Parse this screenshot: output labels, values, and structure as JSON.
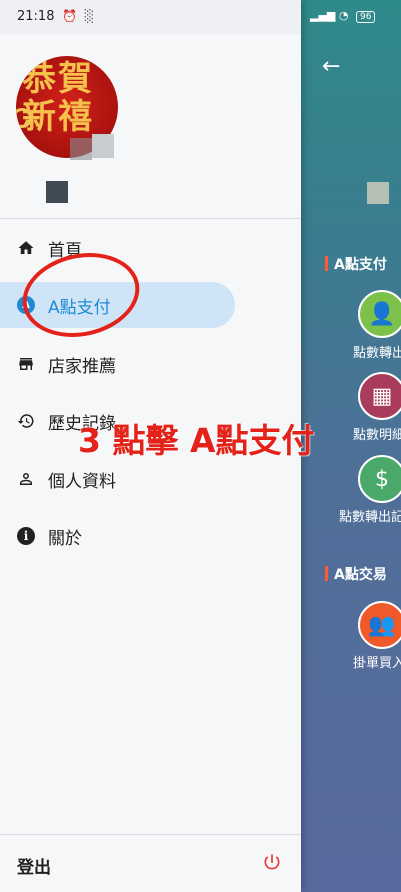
{
  "status_bar": {
    "time": "21:18",
    "left_icons": "⏰ ░",
    "battery": "96"
  },
  "background_app": {
    "back_label": "←",
    "sections": [
      {
        "title": "A點支付"
      },
      {
        "title": "A點交易"
      }
    ],
    "items": [
      {
        "label": "點數轉出",
        "icon": "person-transfer-icon",
        "color": "#7cc24a"
      },
      {
        "label": "點數明細",
        "icon": "calendar-dollar-icon",
        "color": "#a93b5c"
      },
      {
        "label": "點數轉出記錄",
        "icon": "dollar-up-icon",
        "color": "#4aa86a"
      },
      {
        "label": "掛單買入",
        "icon": "people-down-icon",
        "color": "#f05a2a"
      }
    ]
  },
  "drawer": {
    "avatar_text": "恭賀新禧",
    "menu": [
      {
        "label": "首頁",
        "icon": "home-icon"
      },
      {
        "label": "A點支付",
        "icon": "a-point-icon",
        "active": true
      },
      {
        "label": "店家推薦",
        "icon": "store-icon"
      },
      {
        "label": "歷史記錄",
        "icon": "history-icon"
      },
      {
        "label": "個人資料",
        "icon": "person-icon"
      },
      {
        "label": "關於",
        "icon": "info-icon"
      }
    ],
    "logout_label": "登出"
  },
  "annotation": {
    "text": "3 點擊 A點支付",
    "color": "#e32219"
  }
}
